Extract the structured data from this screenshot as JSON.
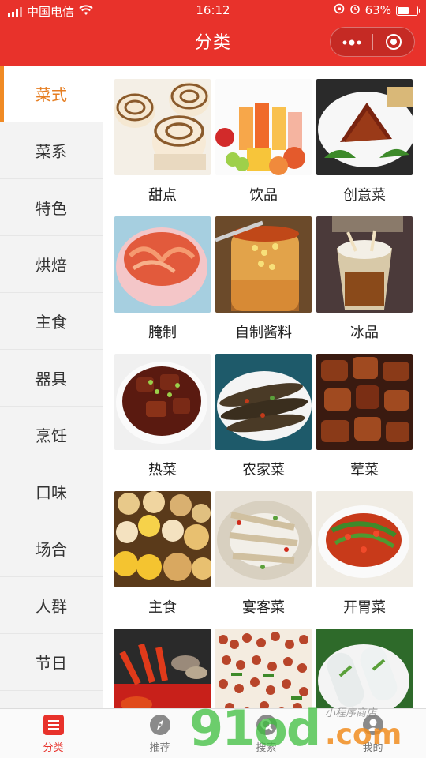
{
  "status_bar": {
    "carrier": "中国电信",
    "time": "16:12",
    "battery": "63%",
    "battery_level": 0.63
  },
  "nav": {
    "title": "分类",
    "more_icon": "more-dots-icon",
    "close_icon": "target-circle-icon"
  },
  "sidebar": {
    "items": [
      {
        "label": "菜式",
        "active": true
      },
      {
        "label": "菜系"
      },
      {
        "label": "特色"
      },
      {
        "label": "烘焙"
      },
      {
        "label": "主食"
      },
      {
        "label": "器具"
      },
      {
        "label": "烹饪"
      },
      {
        "label": "口味"
      },
      {
        "label": "场合"
      },
      {
        "label": "人群"
      },
      {
        "label": "节日"
      }
    ],
    "accent_color": "#f08a24"
  },
  "grid": {
    "items": [
      {
        "label": "甜点",
        "image": "swirl-buns-photo"
      },
      {
        "label": "饮品",
        "image": "juice-glasses-photo"
      },
      {
        "label": "创意菜",
        "image": "braised-pork-plate-photo"
      },
      {
        "label": "腌制",
        "image": "kimchi-bowl-photo"
      },
      {
        "label": "自制酱料",
        "image": "chili-oil-jar-photo"
      },
      {
        "label": "冰品",
        "image": "iced-dessert-glass-photo"
      },
      {
        "label": "热菜",
        "image": "braised-meat-bowl-photo"
      },
      {
        "label": "农家菜",
        "image": "fried-fish-plate-photo"
      },
      {
        "label": "荤菜",
        "image": "spare-ribs-photo"
      },
      {
        "label": "主食",
        "image": "buns-and-breads-photo"
      },
      {
        "label": "宴客菜",
        "image": "fish-platter-photo"
      },
      {
        "label": "开胃菜",
        "image": "chili-fish-plate-photo"
      },
      {
        "label": "",
        "image": "seafood-crayfish-photo"
      },
      {
        "label": "",
        "image": "peanuts-dish-photo"
      },
      {
        "label": "",
        "image": "rice-rolls-photo"
      }
    ]
  },
  "tabbar": {
    "tabs": [
      {
        "label": "分类",
        "icon": "category-list-icon",
        "active": true
      },
      {
        "label": "推荐",
        "icon": "compass-icon"
      },
      {
        "label": "搜索",
        "icon": "search-icon"
      },
      {
        "label": "我的",
        "icon": "user-icon"
      }
    ]
  },
  "watermark": {
    "brand": "91od",
    "suffix": ".com",
    "tagline": "小程序商店"
  },
  "colors": {
    "brand_red": "#e8322b",
    "active_orange": "#e67e22"
  }
}
